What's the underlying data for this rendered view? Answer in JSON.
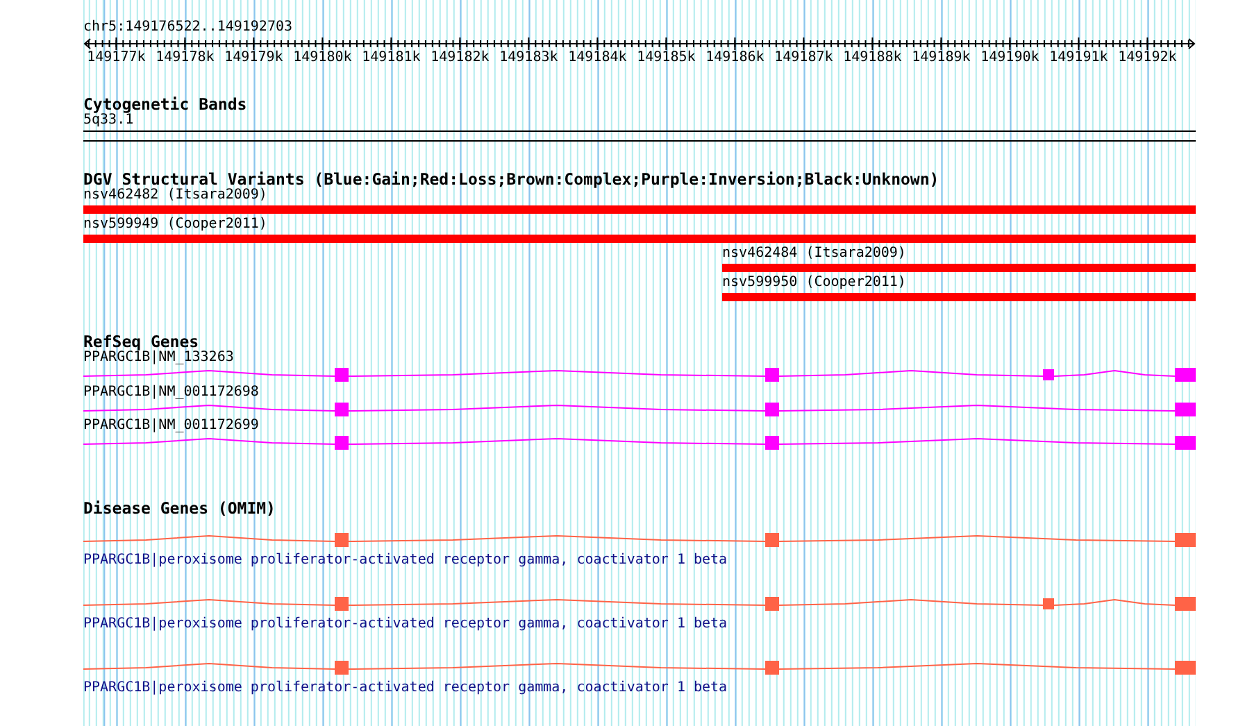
{
  "location": "chr5:149176522..149192703",
  "ruler": {
    "labels": [
      "149177k",
      "149178k",
      "149179k",
      "149180k",
      "149181k",
      "149182k",
      "149183k",
      "149184k",
      "149185k",
      "149186k",
      "149187k",
      "149188k",
      "149189k",
      "149190k",
      "149191k",
      "149192k"
    ]
  },
  "tracks": [
    {
      "kind": "cytoband",
      "title": "Cytogenetic Bands",
      "features": [
        {
          "label": "5q33.1"
        }
      ]
    },
    {
      "kind": "variants",
      "title": "DGV Structural Variants (Blue:Gain;Red:Loss;Brown:Complex;Purple:Inversion;Black:Unknown)",
      "features": [
        {
          "label": "nsv462482 (Itsara2009)",
          "color": "#ff0000"
        },
        {
          "label": "nsv599949 (Cooper2011)",
          "color": "#ff0000"
        },
        {
          "label": "nsv462484 (Itsara2009)",
          "color": "#ff0000"
        },
        {
          "label": "nsv599950 (Cooper2011)",
          "color": "#ff0000"
        }
      ]
    },
    {
      "kind": "transcripts",
      "title": "RefSeq Genes",
      "features": [
        {
          "label": "PPARGC1B|NM_133263"
        },
        {
          "label": "PPARGC1B|NM_001172698"
        },
        {
          "label": "PPARGC1B|NM_001172699"
        }
      ]
    },
    {
      "kind": "disease",
      "title": "Disease Genes (OMIM)",
      "features": [
        {
          "label": "PPARGC1B|peroxisome proliferator-activated receptor gamma, coactivator 1 beta"
        },
        {
          "label": "PPARGC1B|peroxisome proliferator-activated receptor gamma, coactivator 1 beta"
        },
        {
          "label": "PPARGC1B|peroxisome proliferator-activated receptor gamma, coactivator 1 beta"
        }
      ]
    }
  ]
}
